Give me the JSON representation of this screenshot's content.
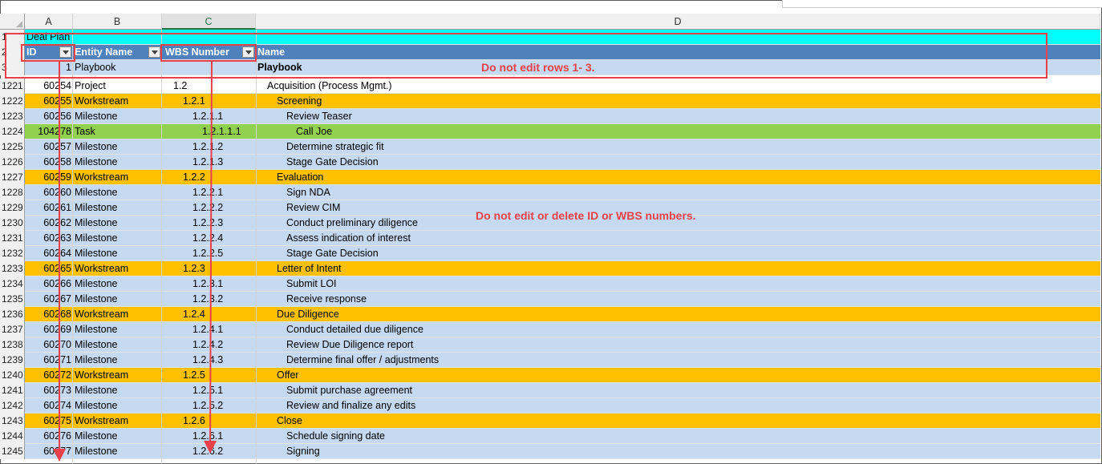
{
  "column_headers": [
    {
      "id": "A",
      "label": "A"
    },
    {
      "id": "B",
      "label": "B"
    },
    {
      "id": "C",
      "label": "C"
    },
    {
      "id": "D",
      "label": "D"
    }
  ],
  "header_rows": [
    {
      "row": "1",
      "title": "Deal Plan"
    },
    {
      "row": "2",
      "id": "ID",
      "entity": "Entity Name",
      "wbs": "WBS Number",
      "name": "Name"
    },
    {
      "row": "3",
      "id": "1",
      "entity": "Playbook",
      "wbs": "",
      "name": "Playbook"
    }
  ],
  "rows": [
    {
      "row": "1221",
      "id": "60254",
      "entity": "Project",
      "wbs": "1.2",
      "name": "Acquisition (Process Mgmt.)",
      "level": 0,
      "type": "project"
    },
    {
      "row": "1222",
      "id": "60255",
      "entity": "Workstream",
      "wbs": "1.2.1",
      "name": "Screening",
      "level": 1,
      "type": "workstream"
    },
    {
      "row": "1223",
      "id": "60256",
      "entity": "Milestone",
      "wbs": "1.2.1.1",
      "name": "Review Teaser",
      "level": 2,
      "type": "milestone"
    },
    {
      "row": "1224",
      "id": "104278",
      "entity": "Task",
      "wbs": "1.2.1.1.1",
      "name": "Call Joe",
      "level": 3,
      "type": "task"
    },
    {
      "row": "1225",
      "id": "60257",
      "entity": "Milestone",
      "wbs": "1.2.1.2",
      "name": "Determine strategic fit",
      "level": 2,
      "type": "milestone"
    },
    {
      "row": "1226",
      "id": "60258",
      "entity": "Milestone",
      "wbs": "1.2.1.3",
      "name": "Stage Gate Decision",
      "level": 2,
      "type": "milestone"
    },
    {
      "row": "1227",
      "id": "60259",
      "entity": "Workstream",
      "wbs": "1.2.2",
      "name": "Evaluation",
      "level": 1,
      "type": "workstream"
    },
    {
      "row": "1228",
      "id": "60260",
      "entity": "Milestone",
      "wbs": "1.2.2.1",
      "name": "Sign NDA",
      "level": 2,
      "type": "milestone"
    },
    {
      "row": "1229",
      "id": "60261",
      "entity": "Milestone",
      "wbs": "1.2.2.2",
      "name": "Review CIM",
      "level": 2,
      "type": "milestone"
    },
    {
      "row": "1230",
      "id": "60262",
      "entity": "Milestone",
      "wbs": "1.2.2.3",
      "name": "Conduct preliminary diligence",
      "level": 2,
      "type": "milestone"
    },
    {
      "row": "1231",
      "id": "60263",
      "entity": "Milestone",
      "wbs": "1.2.2.4",
      "name": "Assess indication of interest",
      "level": 2,
      "type": "milestone"
    },
    {
      "row": "1232",
      "id": "60264",
      "entity": "Milestone",
      "wbs": "1.2.2.5",
      "name": "Stage Gate Decision",
      "level": 2,
      "type": "milestone"
    },
    {
      "row": "1233",
      "id": "60265",
      "entity": "Workstream",
      "wbs": "1.2.3",
      "name": "Letter of Intent",
      "level": 1,
      "type": "workstream"
    },
    {
      "row": "1234",
      "id": "60266",
      "entity": "Milestone",
      "wbs": "1.2.3.1",
      "name": "Submit LOI",
      "level": 2,
      "type": "milestone"
    },
    {
      "row": "1235",
      "id": "60267",
      "entity": "Milestone",
      "wbs": "1.2.3.2",
      "name": "Receive response",
      "level": 2,
      "type": "milestone"
    },
    {
      "row": "1236",
      "id": "60268",
      "entity": "Workstream",
      "wbs": "1.2.4",
      "name": "Due Diligence",
      "level": 1,
      "type": "workstream"
    },
    {
      "row": "1237",
      "id": "60269",
      "entity": "Milestone",
      "wbs": "1.2.4.1",
      "name": "Conduct detailed due diligence",
      "level": 2,
      "type": "milestone"
    },
    {
      "row": "1238",
      "id": "60270",
      "entity": "Milestone",
      "wbs": "1.2.4.2",
      "name": "Review Due Diligence report",
      "level": 2,
      "type": "milestone"
    },
    {
      "row": "1239",
      "id": "60271",
      "entity": "Milestone",
      "wbs": "1.2.4.3",
      "name": "Determine final offer / adjustments",
      "level": 2,
      "type": "milestone"
    },
    {
      "row": "1240",
      "id": "60272",
      "entity": "Workstream",
      "wbs": "1.2.5",
      "name": "Offer",
      "level": 1,
      "type": "workstream"
    },
    {
      "row": "1241",
      "id": "60273",
      "entity": "Milestone",
      "wbs": "1.2.5.1",
      "name": "Submit purchase agreement",
      "level": 2,
      "type": "milestone"
    },
    {
      "row": "1242",
      "id": "60274",
      "entity": "Milestone",
      "wbs": "1.2.5.2",
      "name": "Review and finalize any edits",
      "level": 2,
      "type": "milestone"
    },
    {
      "row": "1243",
      "id": "60275",
      "entity": "Workstream",
      "wbs": "1.2.6",
      "name": "Close",
      "level": 1,
      "type": "workstream"
    },
    {
      "row": "1244",
      "id": "60276",
      "entity": "Milestone",
      "wbs": "1.2.6.1",
      "name": "Schedule signing date",
      "level": 2,
      "type": "milestone"
    },
    {
      "row": "1245",
      "id": "60277",
      "entity": "Milestone",
      "wbs": "1.2.6.2",
      "name": "Signing",
      "level": 2,
      "type": "milestone"
    }
  ],
  "annotations": {
    "note_rows": "Do not edit rows 1- 3.",
    "note_ids": "Do not edit or delete ID or WBS numbers."
  },
  "colors": {
    "title_row": "#00ffff",
    "header_row": "#4f81bd",
    "playbook_row": "#c5d9f1",
    "project_row": "#ffffff",
    "workstream_row": "#ffc000",
    "milestone_row": "#c5d9f1",
    "task_row": "#92d050",
    "annotation_red": "#e8414b"
  }
}
